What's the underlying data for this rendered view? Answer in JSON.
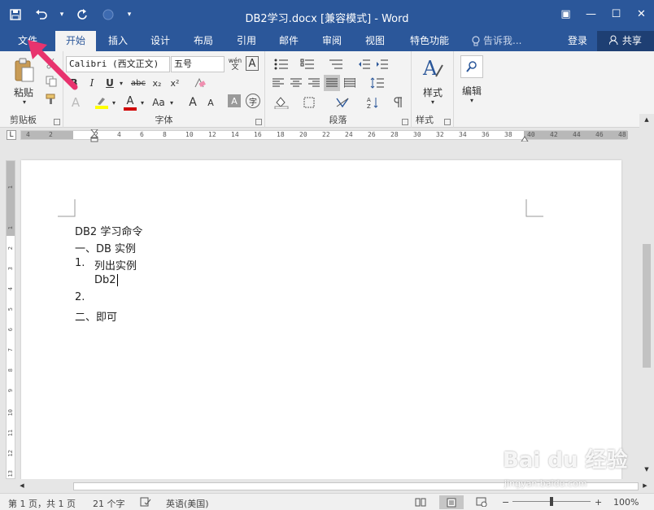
{
  "window": {
    "title": "DB2学习.docx [兼容模式] - Word",
    "controls": {
      "ribbon_display": "▣",
      "minimize": "—",
      "maximize": "☐",
      "close": "✕"
    }
  },
  "quick_access": {
    "save": "💾",
    "undo": "↶",
    "undo_drop": "▾",
    "redo": "↻",
    "customize": "▾"
  },
  "tabs": [
    {
      "label": "文件",
      "active": false
    },
    {
      "label": "开始",
      "active": true
    },
    {
      "label": "插入",
      "active": false
    },
    {
      "label": "设计",
      "active": false
    },
    {
      "label": "布局",
      "active": false
    },
    {
      "label": "引用",
      "active": false
    },
    {
      "label": "邮件",
      "active": false
    },
    {
      "label": "审阅",
      "active": false
    },
    {
      "label": "视图",
      "active": false
    },
    {
      "label": "特色功能",
      "active": false
    }
  ],
  "tell_me": "告诉我...",
  "login": "登录",
  "share": "共享",
  "ribbon": {
    "clipboard": {
      "label": "剪贴板",
      "paste": "粘贴"
    },
    "font": {
      "label": "字体",
      "font_name": "Calibri (西文正文)",
      "font_size": "五号",
      "bold": "B",
      "italic": "I",
      "underline": "U",
      "strike": "abc",
      "subscript": "x₂",
      "superscript": "x²",
      "grow": "A",
      "shrink": "A",
      "case": "Aa",
      "font_color": "A",
      "highlight": "ab",
      "clear": "A",
      "char_shading": "A",
      "enclose": "字",
      "phonetic": "文",
      "char_border": "A"
    },
    "paragraph": {
      "label": "段落"
    },
    "styles": {
      "label": "样式",
      "button": "样式"
    },
    "editing": {
      "label": "",
      "button": "编辑"
    }
  },
  "ruler": {
    "h_ticks": [
      "4",
      "2",
      "",
      "2",
      "4",
      "6",
      "8",
      "10",
      "12",
      "14",
      "16",
      "18",
      "20",
      "22",
      "24",
      "26",
      "28",
      "30",
      "32",
      "34",
      "36",
      "38",
      "40",
      "42",
      "44",
      "46",
      "48"
    ],
    "v_ticks": [
      "1",
      "",
      "1",
      "2",
      "3",
      "4",
      "5",
      "6",
      "7",
      "8",
      "9",
      "10",
      "11",
      "12",
      "13",
      "14"
    ]
  },
  "document": {
    "lines": [
      "DB2 学习命令",
      "一、DB 实例",
      "1.",
      "列出实例",
      "Db2",
      "2.",
      "二、即可"
    ]
  },
  "status": {
    "page": "第 1 页，共 1 页",
    "words": "21 个字",
    "language": "英语(美国)",
    "zoom_minus": "−",
    "zoom_plus": "+",
    "zoom": "100%",
    "zoom_level": 0.5
  },
  "watermark": {
    "main": "Bai du 经验",
    "sub": "jingyan.baidu.com"
  },
  "colors": {
    "accent": "#2b579a",
    "arrow": "#e8336e",
    "highlight": "#ffff00",
    "font_color": "#d00000"
  }
}
